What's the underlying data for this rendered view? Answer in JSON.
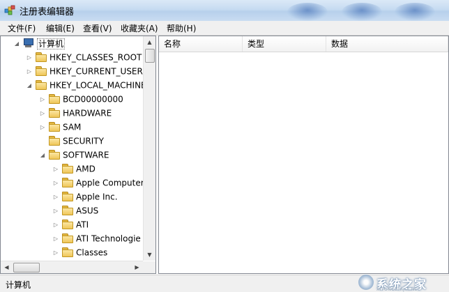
{
  "window": {
    "title": "注册表编辑器",
    "app_icon": "regedit-icon"
  },
  "menu": [
    "文件(F)",
    "编辑(E)",
    "查看(V)",
    "收藏夹(A)",
    "帮助(H)"
  ],
  "tree": {
    "items": [
      {
        "label": "计算机",
        "level": 0,
        "expander": "expanded",
        "icon": "computer-icon",
        "selected": true
      },
      {
        "label": "HKEY_CLASSES_ROOT",
        "level": 1,
        "expander": "collapsed",
        "icon": "folder-icon"
      },
      {
        "label": "HKEY_CURRENT_USER",
        "level": 1,
        "expander": "collapsed",
        "icon": "folder-icon"
      },
      {
        "label": "HKEY_LOCAL_MACHINE",
        "level": 1,
        "expander": "expanded",
        "icon": "folder-icon"
      },
      {
        "label": "BCD00000000",
        "level": 2,
        "expander": "collapsed",
        "icon": "folder-icon"
      },
      {
        "label": "HARDWARE",
        "level": 2,
        "expander": "collapsed",
        "icon": "folder-icon"
      },
      {
        "label": "SAM",
        "level": 2,
        "expander": "collapsed",
        "icon": "folder-icon"
      },
      {
        "label": "SECURITY",
        "level": 2,
        "expander": "none",
        "icon": "folder-icon"
      },
      {
        "label": "SOFTWARE",
        "level": 2,
        "expander": "expanded",
        "icon": "folder-icon"
      },
      {
        "label": "AMD",
        "level": 3,
        "expander": "collapsed",
        "icon": "folder-icon"
      },
      {
        "label": "Apple Computer",
        "level": 3,
        "expander": "collapsed",
        "icon": "folder-icon"
      },
      {
        "label": "Apple Inc.",
        "level": 3,
        "expander": "collapsed",
        "icon": "folder-icon"
      },
      {
        "label": "ASUS",
        "level": 3,
        "expander": "collapsed",
        "icon": "folder-icon"
      },
      {
        "label": "ATI",
        "level": 3,
        "expander": "collapsed",
        "icon": "folder-icon"
      },
      {
        "label": "ATI Technologie",
        "level": 3,
        "expander": "collapsed",
        "icon": "folder-icon"
      },
      {
        "label": "Classes",
        "level": 3,
        "expander": "collapsed",
        "icon": "folder-icon"
      }
    ]
  },
  "list": {
    "columns": [
      "名称",
      "类型",
      "数据"
    ]
  },
  "status": {
    "path": "计算机"
  },
  "watermark": {
    "text": "系统之家",
    "url": "XITONGZHIJIA.NET"
  },
  "colors": {
    "titlebar": "#c6dbf1",
    "menubar": "#f0f0f0",
    "folder": "#efc659",
    "border": "#828790"
  }
}
